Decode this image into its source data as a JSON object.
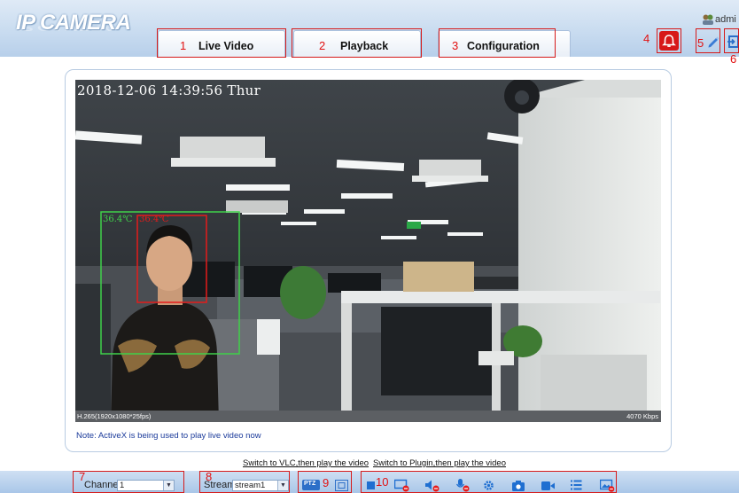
{
  "header": {
    "app_title": "IP CAMERA",
    "user": "admi",
    "tabs": [
      {
        "label": "Live Video",
        "marker": "1"
      },
      {
        "label": "Playback",
        "marker": "2"
      },
      {
        "label": "Configuration",
        "marker": "3"
      }
    ],
    "markers": {
      "alarm": "4",
      "change_password": "5",
      "logout": "6"
    }
  },
  "video": {
    "osd_timestamp": "2018-12-06 14:39:56 Thur",
    "face_temperature_1": "36.4℃",
    "face_temperature_2": "36.4℃",
    "codec_info": "H.265(1920x1080*25fps)",
    "bitrate": "4070 Kbps"
  },
  "note": "Note: ActiveX is being used to play live video now",
  "links": {
    "switch_vlc": "Switch to VLC,then play the video",
    "switch_plugin": "Switch to Plugin,then play the video"
  },
  "toolbar": {
    "channel_label": "Channel",
    "channel_value": "1",
    "stream_label": "Stream",
    "stream_value": "stream1",
    "ptz_label": "PTZ",
    "markers": {
      "channel": "7",
      "stream": "8",
      "ptz": "9",
      "controls": "10"
    },
    "icons": [
      "stop-icon",
      "snapshot-off-icon",
      "audio-off-icon",
      "mic-off-icon",
      "settings-icon",
      "camera-icon",
      "record-icon",
      "list-icon",
      "image-off-icon"
    ]
  },
  "colors": {
    "highlight_red": "#d61a1a",
    "accent_blue": "#1f6fd1",
    "header_blue": "#c9dcf0"
  }
}
